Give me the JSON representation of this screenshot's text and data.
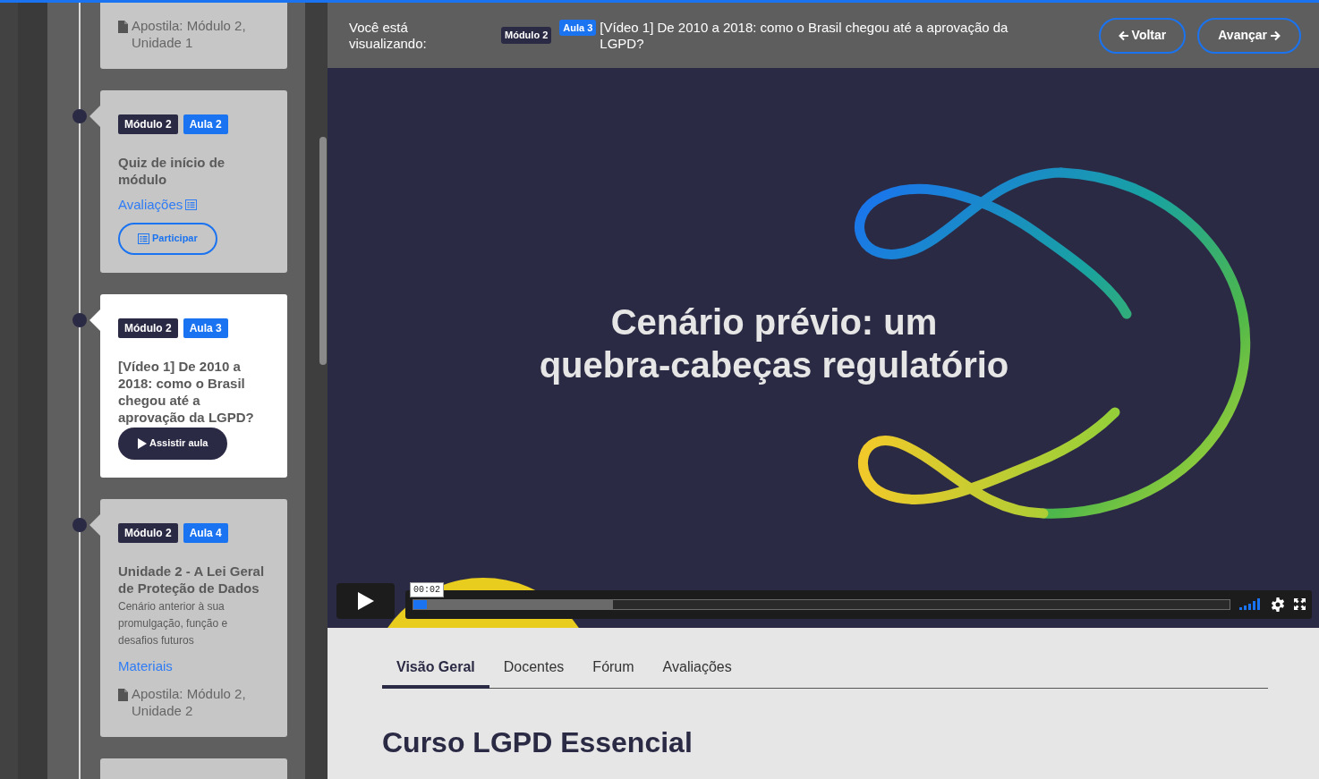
{
  "sidebar": {
    "cards": [
      {
        "selected": false,
        "files": [
          "Apostila: Módulo 2, Unidade 1"
        ]
      },
      {
        "selected": false,
        "module": "Módulo 2",
        "lesson": "Aula 2",
        "title": "Quiz de início de módulo",
        "link": {
          "label": "Avaliações",
          "icon": true
        },
        "button": {
          "kind": "outline",
          "label": "Participar"
        }
      },
      {
        "selected": true,
        "module": "Módulo 2",
        "lesson": "Aula 3",
        "title": "[Vídeo 1] De 2010 a 2018: como o Brasil chegou até a aprovação da LGPD?",
        "button": {
          "kind": "solid",
          "label": "Assistir aula"
        }
      },
      {
        "selected": false,
        "module": "Módulo 2",
        "lesson": "Aula 4",
        "title": "Unidade 2 - A Lei Geral de Proteção de Dados",
        "description": "Cenário anterior à sua promulgação, função e desafios futuros",
        "link": {
          "label": "Materiais",
          "icon": false
        },
        "files": [
          "Apostila: Módulo 2, Unidade 2"
        ]
      },
      {
        "selected": false
      }
    ]
  },
  "header": {
    "label": "Você está visualizando:",
    "module": "Módulo 2",
    "lesson": "Aula 3",
    "title": "[Vídeo 1] De 2010 a 2018: como o Brasil chegou até a aprovação da LGPD?",
    "buttons": [
      {
        "kind": "back",
        "label": "Voltar"
      },
      {
        "kind": "next",
        "label": "Avançar"
      }
    ]
  },
  "video": {
    "slide_title_lines": [
      "Cenário prévio: um",
      "quebra-cabeças regulatório"
    ],
    "time": "00:02",
    "progress": {
      "level": 0.016
    },
    "buffered": {
      "level": 0.244
    }
  },
  "tabs": [
    {
      "label": "Visão Geral",
      "selected": true
    },
    {
      "label": "Docentes",
      "selected": false
    },
    {
      "label": "Fórum",
      "selected": false
    },
    {
      "label": "Avaliações",
      "selected": false
    }
  ],
  "course_title": "Curso LGPD Essencial"
}
